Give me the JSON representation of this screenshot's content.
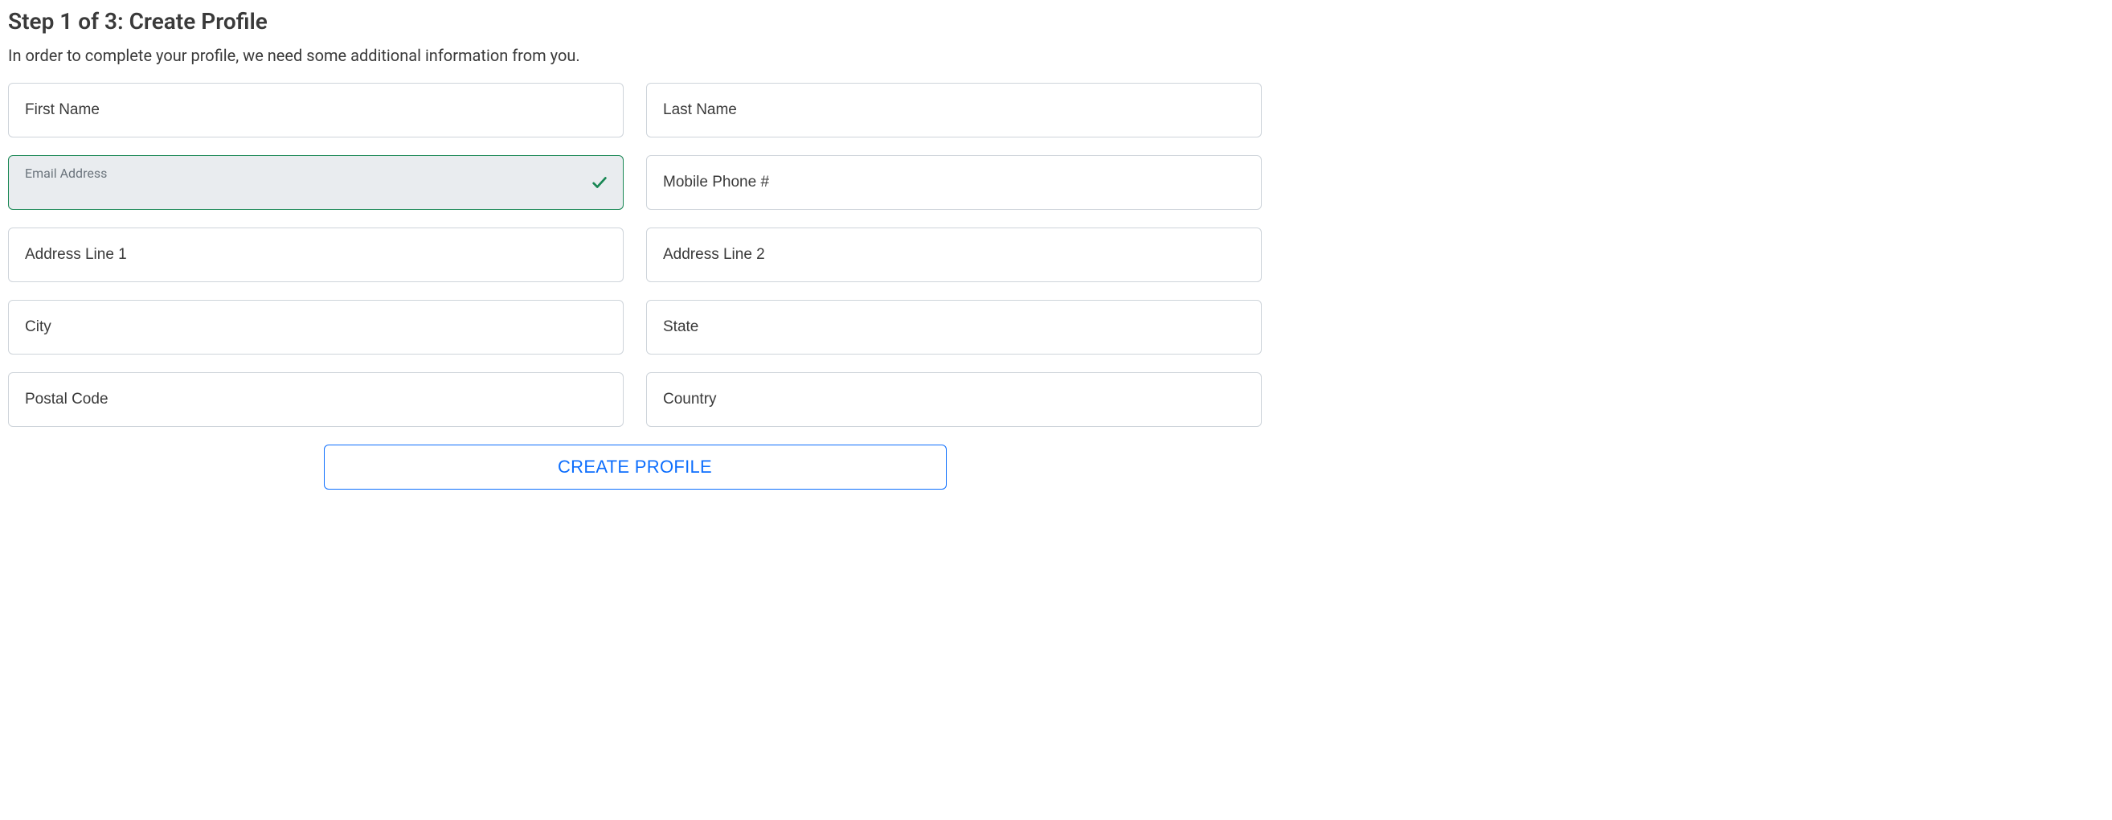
{
  "header": {
    "title": "Step 1 of 3: Create Profile",
    "subtitle": "In order to complete your profile, we need some additional information from you."
  },
  "fields": {
    "first_name": {
      "placeholder": "First Name",
      "value": ""
    },
    "last_name": {
      "placeholder": "Last Name",
      "value": ""
    },
    "email": {
      "label": "Email Address",
      "valid": true
    },
    "mobile": {
      "placeholder": "Mobile Phone #",
      "value": ""
    },
    "address1": {
      "placeholder": "Address Line 1",
      "value": ""
    },
    "address2": {
      "placeholder": "Address Line 2",
      "value": ""
    },
    "city": {
      "placeholder": "City",
      "value": ""
    },
    "state": {
      "placeholder": "State",
      "value": ""
    },
    "postal": {
      "placeholder": "Postal Code",
      "value": ""
    },
    "country": {
      "placeholder": "Country",
      "value": ""
    }
  },
  "actions": {
    "submit_label": "CREATE PROFILE"
  },
  "colors": {
    "valid_border": "#198754",
    "valid_bg": "#e9ecef",
    "primary": "#0d6efd",
    "input_border": "#ced4da"
  }
}
